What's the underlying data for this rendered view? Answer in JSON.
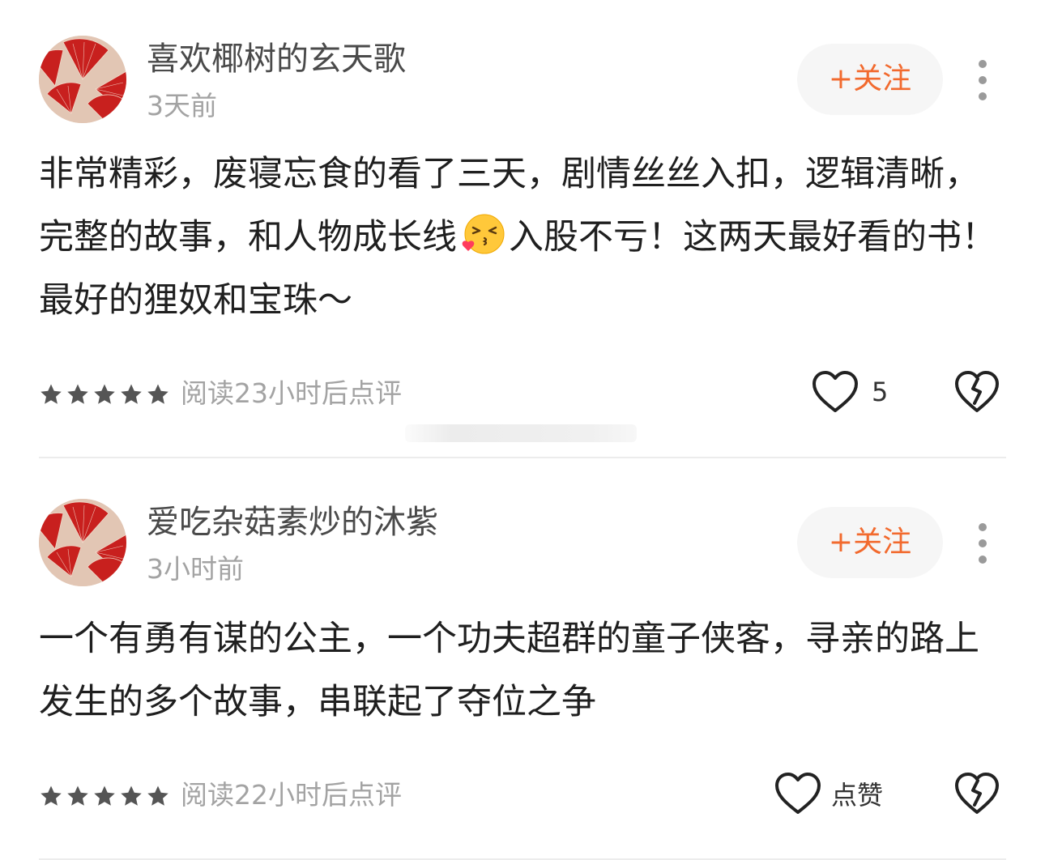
{
  "comments": [
    {
      "username": "喜欢椰树的玄天歌",
      "time": "3天前",
      "follow_label": "+关注",
      "content_before_emoji": "非常精彩，废寝忘食的看了三天，剧情丝丝入扣，逻辑清晰，完整的故事，和人物成长线",
      "emoji": "kissing-face-with-heart-emoji",
      "content_after_emoji": "入股不亏！这两天最好看的书！最好的狸奴和宝珠～",
      "rating": 5,
      "read_note": "阅读23小时后点评",
      "like_text": "5"
    },
    {
      "username": "爱吃杂菇素炒的沐紫",
      "time": "3小时前",
      "follow_label": "+关注",
      "content": "一个有勇有谋的公主，一个功夫超群的童子侠客，寻亲的路上发生的多个故事，串联起了夺位之争",
      "rating": 5,
      "read_note": "阅读22小时后点评",
      "like_text": "点赞"
    }
  ],
  "icons": {
    "avatar": "red-folding-fans-avatar",
    "more": "more-vertical-icon",
    "star": "star-icon",
    "like": "heart-outline-icon",
    "dislike": "broken-heart-icon"
  },
  "colors": {
    "accent": "#f26a2e",
    "follow_bg": "#f6f6f6",
    "secondary_text": "#a3a3a3",
    "star": "#555555",
    "avatar_bg": "#e2c6b4",
    "fan_red": "#c8201e"
  }
}
